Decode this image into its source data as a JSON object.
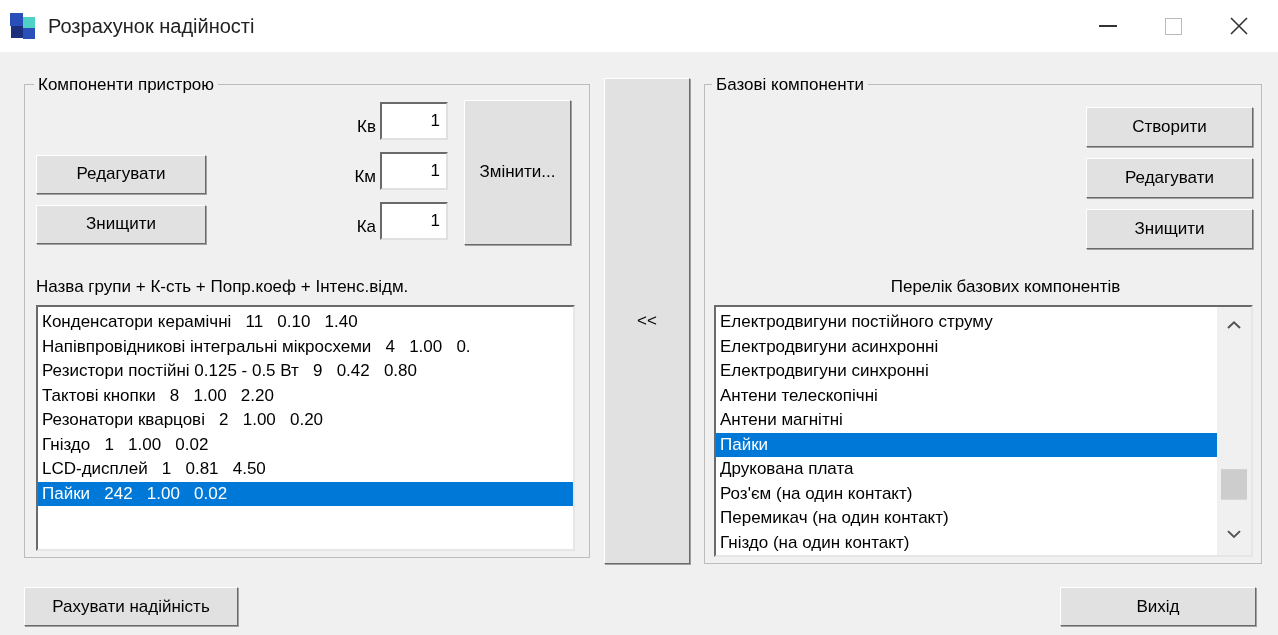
{
  "window": {
    "title": "Розрахунок надійності"
  },
  "device_group": {
    "title": "Компоненти пристрою",
    "buttons": [
      "Редагувати",
      "Знищити"
    ],
    "coefficients": [
      {
        "label": "Кв",
        "value": "1"
      },
      {
        "label": "Км",
        "value": "1"
      },
      {
        "label": "Ка",
        "value": "1"
      }
    ],
    "change_button": "Змінити...",
    "list_caption": "Назва групи + К-сть + Попр.коеф + Інтенс.відм.",
    "items": [
      {
        "text": "Конденсатори керамічні   11   0.10   1.40",
        "selected": false
      },
      {
        "text": "Напівпровідникові інтегральні мікросхеми   4   1.00   0.",
        "selected": false
      },
      {
        "text": "Резистори постійні 0.125 - 0.5 Вт   9   0.42   0.80",
        "selected": false
      },
      {
        "text": "Тактові кнопки   8   1.00   2.20",
        "selected": false
      },
      {
        "text": "Резонатори кварцові   2   1.00   0.20",
        "selected": false
      },
      {
        "text": "Гніздо   1   1.00   0.02",
        "selected": false
      },
      {
        "text": "LCD-дисплей   1   0.81   4.50",
        "selected": false
      },
      {
        "text": "Пайки   242   1.00   0.02",
        "selected": true
      }
    ]
  },
  "move_button": "<<",
  "base_group": {
    "title": "Базові компоненти",
    "buttons": [
      "Створити",
      "Редагувати",
      "Знищити"
    ],
    "list_caption": "Перелік базових компонентів",
    "items": [
      {
        "text": "Електродвигуни постійного струму",
        "selected": false
      },
      {
        "text": "Електродвигуни асинхронні",
        "selected": false
      },
      {
        "text": "Електродвигуни синхронні",
        "selected": false
      },
      {
        "text": "Антени телескопічні",
        "selected": false
      },
      {
        "text": "Антени магнітні",
        "selected": false
      },
      {
        "text": "Пайки",
        "selected": true
      },
      {
        "text": "Друкована плата",
        "selected": false
      },
      {
        "text": "Роз'єм (на один контакт)",
        "selected": false
      },
      {
        "text": "Перемикач (на один контакт)",
        "selected": false
      },
      {
        "text": "Гніздо (на один контакт)",
        "selected": false
      }
    ]
  },
  "footer": {
    "calc_button": "Рахувати надійність",
    "exit_button": "Вихід"
  }
}
